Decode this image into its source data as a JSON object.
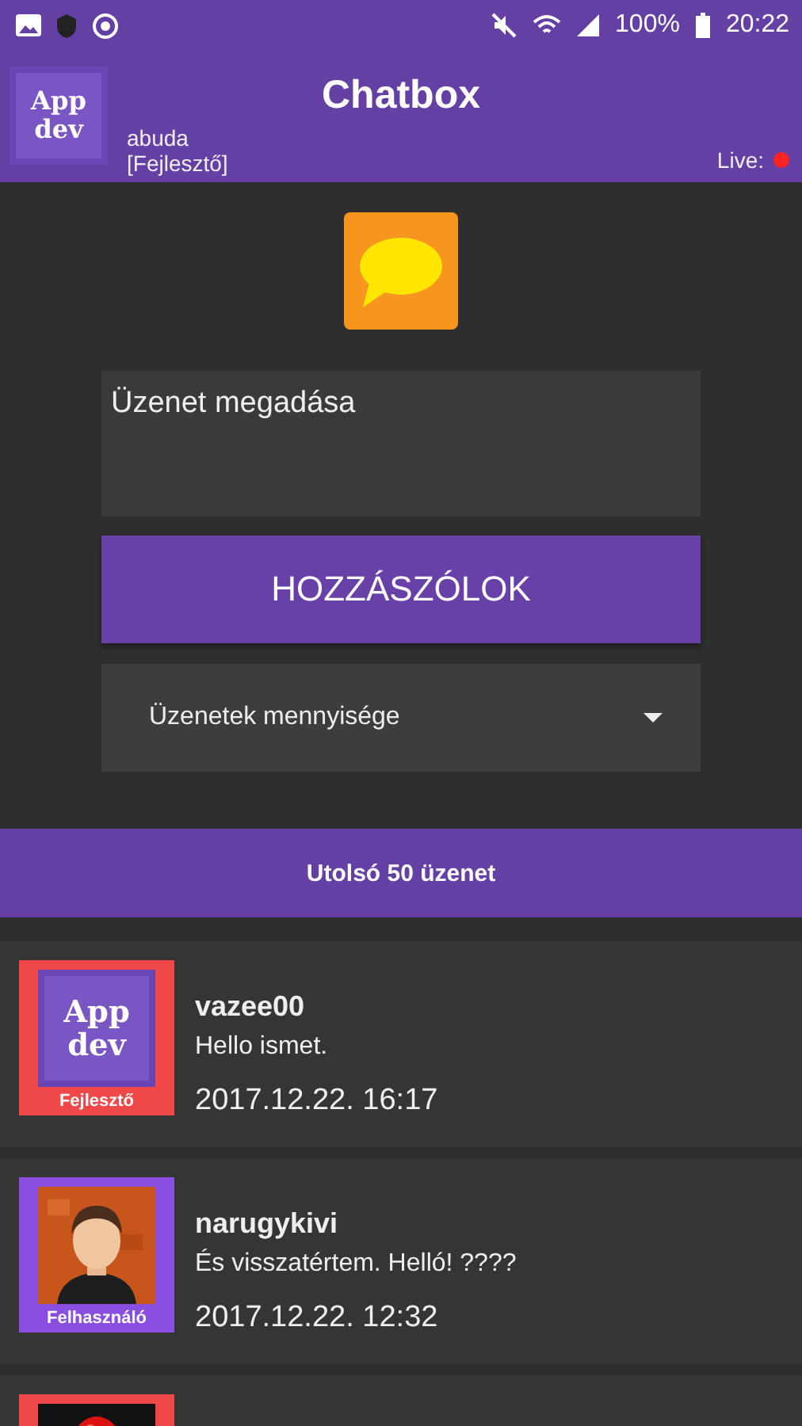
{
  "status_bar": {
    "battery": "100%",
    "time": "20:22"
  },
  "header": {
    "logo": "App dev",
    "title": "Chatbox",
    "user": "abuda",
    "role": "[Fejlesztő]",
    "live": {
      "label": "Live:",
      "on": false
    }
  },
  "composer": {
    "placeholder": "Üzenet megadása",
    "button": "HOZZÁSZÓLOK",
    "dropdown": "Üzenetek mennyisége"
  },
  "banner": "Utolsó 50 üzenet",
  "messages": [
    {
      "kind": "logo",
      "logo": "App dev",
      "role": "Fejlesztő",
      "color": "#f04848",
      "name": "vazee00",
      "text": "Hello ismet.",
      "time": "2017.12.22. 16:17"
    },
    {
      "kind": "picture",
      "role": "Felhasználó",
      "color": "#8a4fe0",
      "name": "narugykivi",
      "text": "És visszatértem. Helló! ????",
      "time": "2017.12.22. 12:32"
    },
    {
      "kind": "picture",
      "color": "#f04848"
    }
  ]
}
